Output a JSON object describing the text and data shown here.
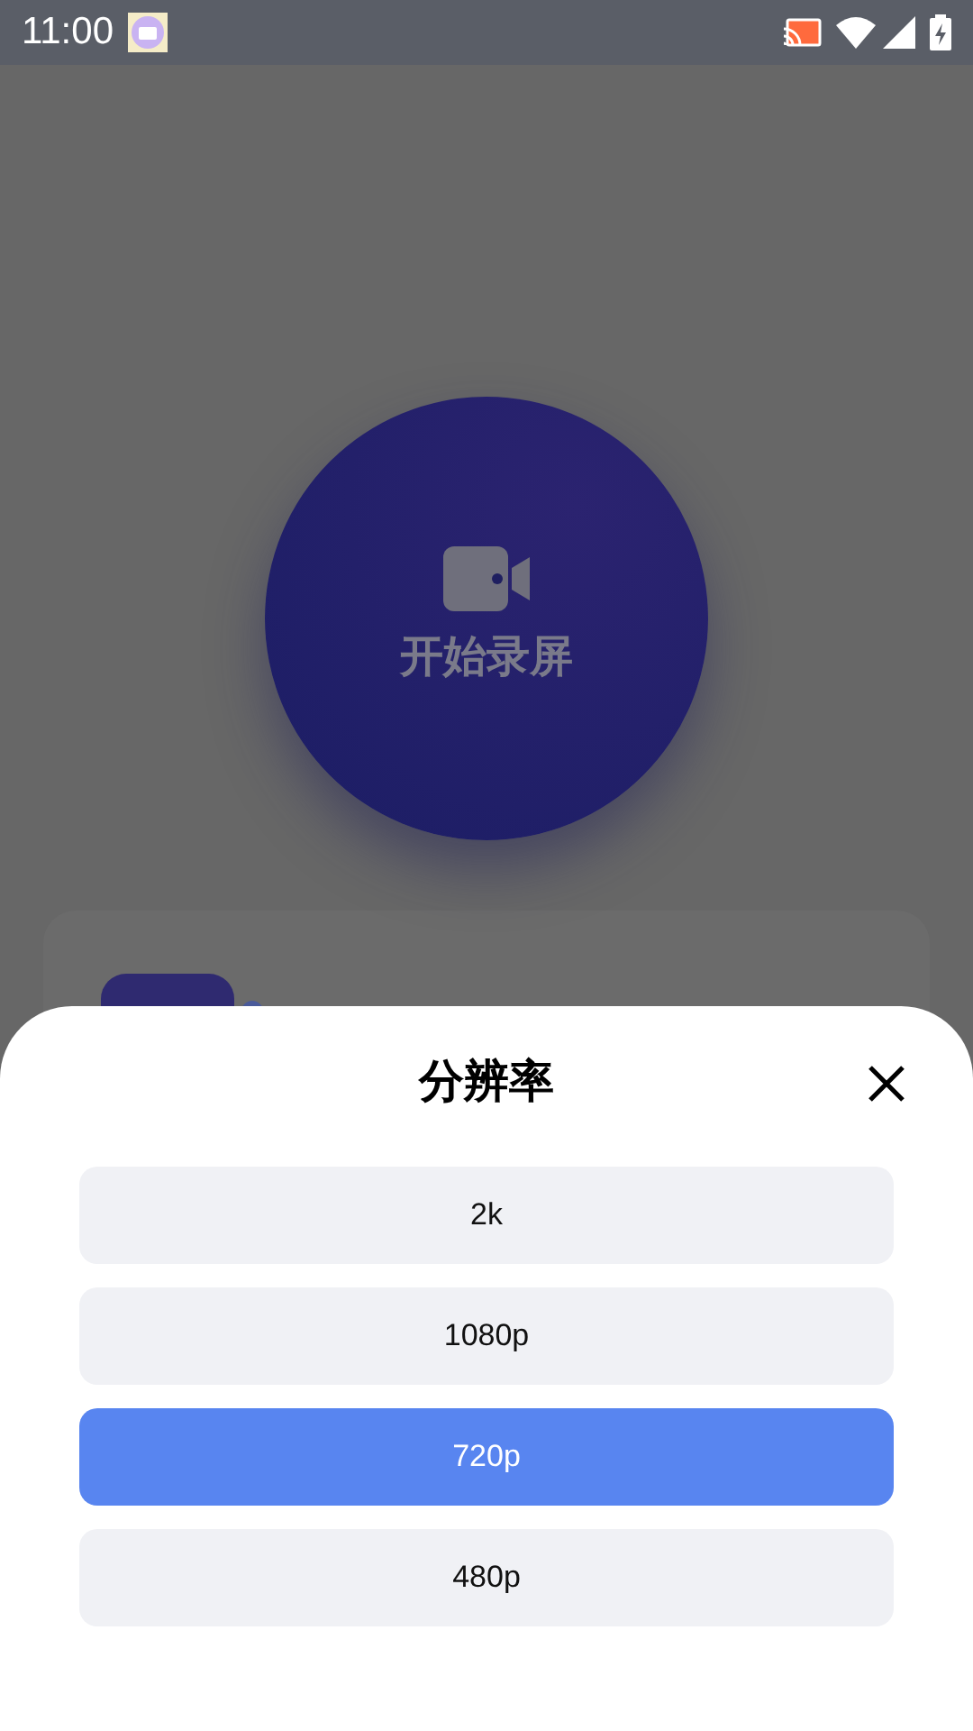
{
  "status_bar": {
    "time": "11:00"
  },
  "record_button": {
    "label": "开始录屏"
  },
  "sheet": {
    "title": "分辨率",
    "options": [
      {
        "label": "2k",
        "selected": false
      },
      {
        "label": "1080p",
        "selected": false
      },
      {
        "label": "720p",
        "selected": true
      },
      {
        "label": "480p",
        "selected": false
      }
    ]
  }
}
